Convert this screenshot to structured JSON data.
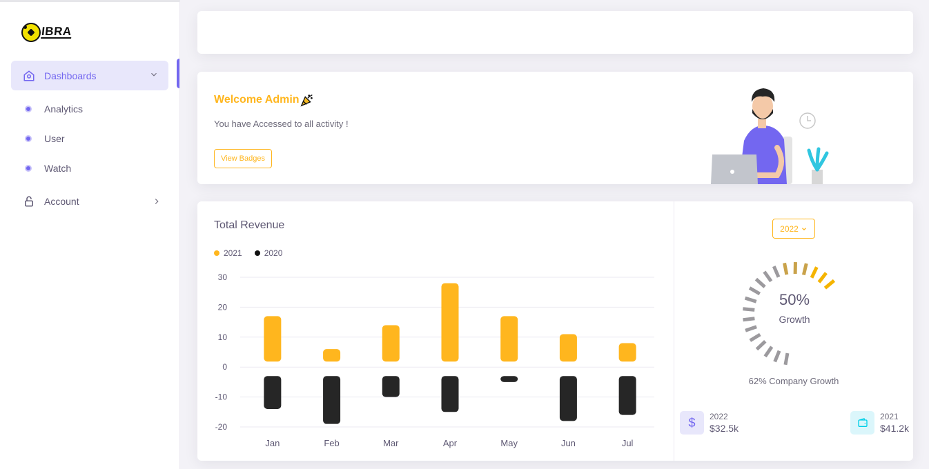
{
  "brand": {
    "name": "IBRA"
  },
  "sidebar": {
    "dashboards": {
      "label": "Dashboards",
      "icon": "home-icon"
    },
    "items": [
      {
        "label": "Analytics"
      },
      {
        "label": "User"
      },
      {
        "label": "Watch"
      }
    ],
    "account": {
      "label": "Account",
      "icon": "lock-icon"
    }
  },
  "welcome": {
    "title": "Welcome Admin",
    "subtitle": "You have Accessed to all activity !",
    "button": "View Badges"
  },
  "revenue": {
    "title": "Total Revenue",
    "year_select": "2022",
    "growth_percent": "50%",
    "growth_label": "Growth",
    "company_growth": "62% Company Growth",
    "stats": [
      {
        "year": "2022",
        "amount": "$32.5k",
        "icon": "dollar-icon"
      },
      {
        "year": "2021",
        "amount": "$41.2k",
        "icon": "wallet-icon"
      }
    ]
  },
  "colors": {
    "accent": "#7367f0",
    "warning": "#ffb61e",
    "dark": "#262626"
  },
  "chart_data": {
    "type": "bar",
    "title": "Total Revenue",
    "categories": [
      "Jan",
      "Feb",
      "Mar",
      "Apr",
      "May",
      "Jun",
      "Jul"
    ],
    "series": [
      {
        "name": "2021",
        "values": [
          17,
          6,
          14,
          28,
          17,
          11,
          8
        ],
        "color": "#ffb61e"
      },
      {
        "name": "2020",
        "values": [
          -14,
          -19,
          -10,
          -15,
          -5,
          -18,
          -16
        ],
        "color": "#262626"
      }
    ],
    "y_ticks": [
      30,
      20,
      10,
      0,
      -10,
      -20
    ],
    "ylim": [
      -20,
      30
    ],
    "grid": true,
    "legend": "top-left",
    "stacked": true
  }
}
